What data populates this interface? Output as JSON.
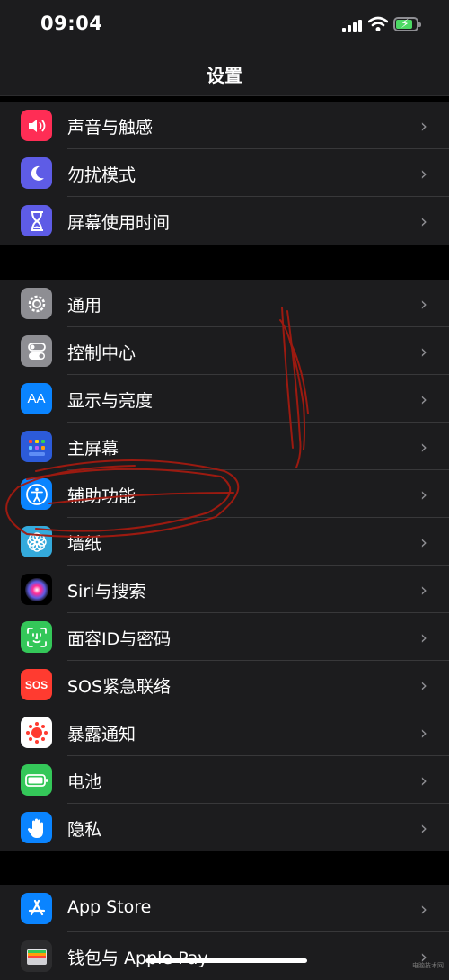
{
  "status_bar": {
    "time": "09:04"
  },
  "nav": {
    "title": "设置"
  },
  "groups": [
    {
      "items": [
        {
          "label": "声音与触感",
          "icon": "speaker-icon",
          "color": "#ff2d55"
        },
        {
          "label": "勿扰模式",
          "icon": "moon-icon",
          "color": "#5e5ce6"
        },
        {
          "label": "屏幕使用时间",
          "icon": "hourglass-icon",
          "color": "#5e5ce6"
        }
      ]
    },
    {
      "items": [
        {
          "label": "通用",
          "icon": "gear-icon",
          "color": "#8e8e93"
        },
        {
          "label": "控制中心",
          "icon": "toggles-icon",
          "color": "#8e8e93"
        },
        {
          "label": "显示与亮度",
          "icon": "text-size-icon",
          "color": "#0a84ff"
        },
        {
          "label": "主屏幕",
          "icon": "home-grid-icon",
          "color": "#2c5bd9"
        },
        {
          "label": "辅助功能",
          "icon": "accessibility-icon",
          "color": "#0a84ff"
        },
        {
          "label": "墙纸",
          "icon": "flower-icon",
          "color": "#34aadc"
        },
        {
          "label": "Siri与搜索",
          "icon": "siri-icon",
          "color": "#1c1c1e"
        },
        {
          "label": "面容ID与密码",
          "icon": "face-id-icon",
          "color": "#34c759"
        },
        {
          "label": "SOS紧急联络",
          "icon": "sos-icon",
          "color": "#ff3b30",
          "icon_text": "SOS"
        },
        {
          "label": "暴露通知",
          "icon": "exposure-icon",
          "color": "#ff3b30"
        },
        {
          "label": "电池",
          "icon": "battery-icon",
          "color": "#34c759"
        },
        {
          "label": "隐私",
          "icon": "hand-icon",
          "color": "#0a84ff"
        }
      ]
    },
    {
      "items": [
        {
          "label": "App Store",
          "icon": "app-store-icon",
          "color": "#0a84ff"
        },
        {
          "label": "钱包与 Apple Pay",
          "icon": "wallet-icon",
          "color": "#1c1c1e"
        }
      ]
    }
  ],
  "chevron": "›",
  "watermark": "电脑技术网"
}
